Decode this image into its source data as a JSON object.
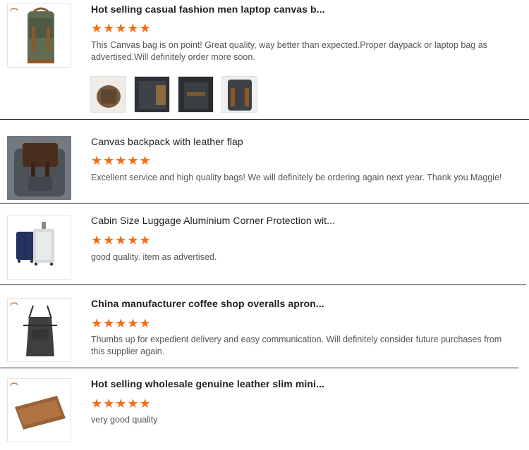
{
  "reviews": [
    {
      "title": "Hot selling casual fashion men laptop canvas b...",
      "stars": "★★★★★",
      "text": "This Canvas bag is on point! Great quality, way better than expected.Proper daypack or laptop bag as advertised.Will definitely order more soon."
    },
    {
      "title": "Canvas backpack with leather flap",
      "stars": "★★★★★",
      "text": "Excellent service and high quality bags! We will definitely be ordering again next year. Thank you Maggie!"
    },
    {
      "title": "Cabin Size Luggage Aluminium Corner Protection wit...",
      "stars": "★★★★★",
      "text": "good quality. item as advertised."
    },
    {
      "title": "China manufacturer coffee shop overalls apron...",
      "stars": "★★★★★",
      "text": "Thumbs up for expedient delivery and easy communication. Will definitely consider future purchases from this supplier again."
    },
    {
      "title": "Hot selling wholesale genuine leather slim mini...",
      "stars": "★★★★★",
      "text": "very good quality"
    }
  ],
  "colors": {
    "star": "#f46e16",
    "divider": "#222222",
    "text": "#555555"
  },
  "icons": [
    "brand-logo-icon",
    "star-icon"
  ]
}
